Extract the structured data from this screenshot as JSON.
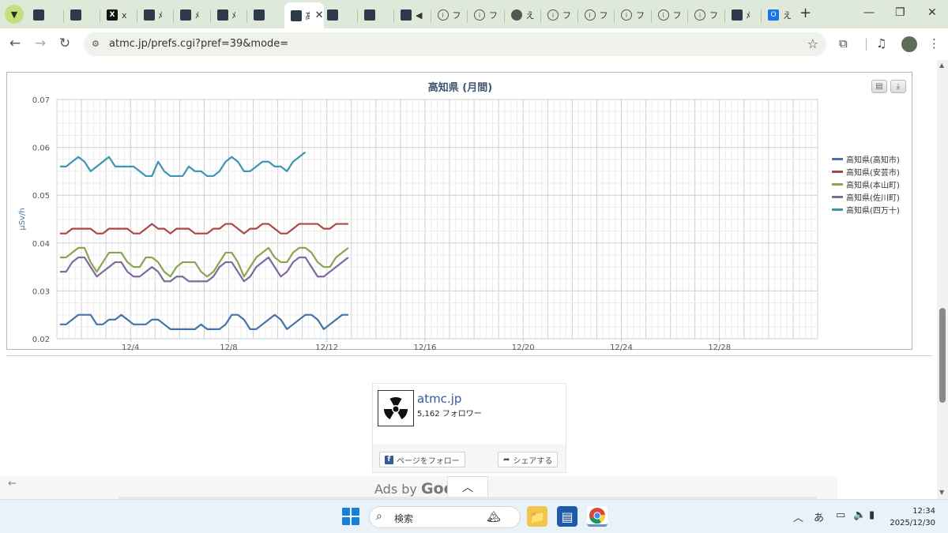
{
  "browser": {
    "tabs": [
      {
        "icon": "site-icon",
        "label": ""
      },
      {
        "icon": "site-icon",
        "label": ""
      },
      {
        "icon": "x-logo-icon",
        "label": "x"
      },
      {
        "icon": "site-icon",
        "label": "ﾒ"
      },
      {
        "icon": "site-icon",
        "label": "ﾒ"
      },
      {
        "icon": "site-icon",
        "label": "ﾒ"
      },
      {
        "icon": "site-icon",
        "label": ""
      },
      {
        "icon": "site-icon",
        "label": "高",
        "active": true
      },
      {
        "icon": "site-icon",
        "label": ""
      },
      {
        "icon": "site-icon",
        "label": ""
      },
      {
        "icon": "site-icon",
        "label": "◀"
      },
      {
        "icon": "info-icon",
        "label": "フ"
      },
      {
        "icon": "info-icon",
        "label": "フ"
      },
      {
        "icon": "globe-icon",
        "label": "え"
      },
      {
        "icon": "info-icon",
        "label": "フ"
      },
      {
        "icon": "info-icon",
        "label": "フ"
      },
      {
        "icon": "info-icon",
        "label": "フ"
      },
      {
        "icon": "info-icon",
        "label": "フ"
      },
      {
        "icon": "info-icon",
        "label": "フ"
      },
      {
        "icon": "site-icon",
        "label": "ﾒ"
      },
      {
        "icon": "outlook-icon",
        "label": "え"
      }
    ],
    "new_tab": "+",
    "url": "atmc.jp/prefs.cgi?pref=39&mode="
  },
  "chart": {
    "title": "高知県 (月間)",
    "ylabel": "μSv/h"
  },
  "chart_data": {
    "type": "line",
    "title": "高知県 (月間)",
    "ylabel": "μSv/h",
    "ylim": [
      0.02,
      0.07
    ],
    "yticks": [
      "0.07",
      "0.06",
      "0.05",
      "0.04",
      "0.03",
      "0.02"
    ],
    "xticks": [
      "12/4",
      "12/8",
      "12/12",
      "12/16",
      "12/20",
      "12/24",
      "12/28"
    ],
    "x_start": "12/1",
    "x_end": "12/31",
    "points_per_day": 4,
    "grid": true,
    "legend_position": "right",
    "series": [
      {
        "name": "高知県(高知市)",
        "color": "#4572a7",
        "values": [
          0.023,
          0.023,
          0.024,
          0.025,
          0.025,
          0.025,
          0.023,
          0.023,
          0.024,
          0.024,
          0.025,
          0.024,
          0.023,
          0.023,
          0.023,
          0.024,
          0.024,
          0.023,
          0.022,
          0.022,
          0.022,
          0.022,
          0.022,
          0.023,
          0.022,
          0.022,
          0.022,
          0.023,
          0.025,
          0.025,
          0.024,
          0.022,
          0.022,
          0.023,
          0.024,
          0.025,
          0.024,
          0.022,
          0.023,
          0.024,
          0.025,
          0.025,
          0.024,
          0.022,
          0.023,
          0.024,
          0.025,
          0.025
        ]
      },
      {
        "name": "高知県(安芸市)",
        "color": "#aa4643",
        "values": [
          0.042,
          0.042,
          0.043,
          0.043,
          0.043,
          0.043,
          0.042,
          0.042,
          0.043,
          0.043,
          0.043,
          0.043,
          0.042,
          0.042,
          0.043,
          0.044,
          0.043,
          0.043,
          0.042,
          0.043,
          0.043,
          0.043,
          0.042,
          0.042,
          0.042,
          0.043,
          0.043,
          0.044,
          0.044,
          0.043,
          0.042,
          0.043,
          0.043,
          0.044,
          0.044,
          0.043,
          0.042,
          0.042,
          0.043,
          0.044,
          0.044,
          0.044,
          0.044,
          0.043,
          0.043,
          0.044,
          0.044,
          0.044
        ]
      },
      {
        "name": "高知県(本山町)",
        "color": "#89a54e",
        "values": [
          0.037,
          0.037,
          0.038,
          0.039,
          0.039,
          0.036,
          0.034,
          0.036,
          0.038,
          0.038,
          0.038,
          0.036,
          0.035,
          0.035,
          0.037,
          0.037,
          0.036,
          0.034,
          0.033,
          0.035,
          0.036,
          0.036,
          0.036,
          0.034,
          0.033,
          0.034,
          0.036,
          0.038,
          0.038,
          0.036,
          0.033,
          0.035,
          0.037,
          0.038,
          0.039,
          0.037,
          0.036,
          0.036,
          0.038,
          0.039,
          0.039,
          0.038,
          0.036,
          0.035,
          0.035,
          0.037,
          0.038,
          0.039
        ]
      },
      {
        "name": "高知県(佐川町)",
        "color": "#80699b",
        "values": [
          0.034,
          0.034,
          0.036,
          0.037,
          0.037,
          0.035,
          0.033,
          0.034,
          0.035,
          0.036,
          0.036,
          0.034,
          0.033,
          0.033,
          0.034,
          0.035,
          0.034,
          0.032,
          0.032,
          0.033,
          0.033,
          0.032,
          0.032,
          0.032,
          0.032,
          0.033,
          0.035,
          0.036,
          0.036,
          0.034,
          0.032,
          0.033,
          0.035,
          0.036,
          0.037,
          0.035,
          0.033,
          0.034,
          0.036,
          0.037,
          0.037,
          0.035,
          0.033,
          0.033,
          0.034,
          0.035,
          0.036,
          0.037
        ]
      },
      {
        "name": "高知県(四万十)",
        "color": "#3d96ae",
        "values": [
          0.056,
          0.056,
          0.057,
          0.058,
          0.057,
          0.055,
          0.056,
          0.057,
          0.058,
          0.056,
          0.056,
          0.056,
          0.056,
          0.055,
          0.054,
          0.054,
          0.057,
          0.055,
          0.054,
          0.054,
          0.054,
          0.056,
          0.055,
          0.055,
          0.054,
          0.054,
          0.055,
          0.057,
          0.058,
          0.057,
          0.055,
          0.055,
          0.056,
          0.057,
          0.057,
          0.056,
          0.056,
          0.055,
          0.057,
          0.058,
          0.059
        ]
      }
    ]
  },
  "facebook": {
    "name": "atmc.jp",
    "followers": "5,162 フォロワー",
    "follow_label": "ページをフォロー",
    "share_label": "シェアする"
  },
  "ads": {
    "label_prefix": "Ads by ",
    "label_brand": "Goo"
  },
  "taskbar": {
    "search_placeholder": "検索",
    "ime": "あ",
    "time": "12:34",
    "date": "2025/12/30"
  }
}
